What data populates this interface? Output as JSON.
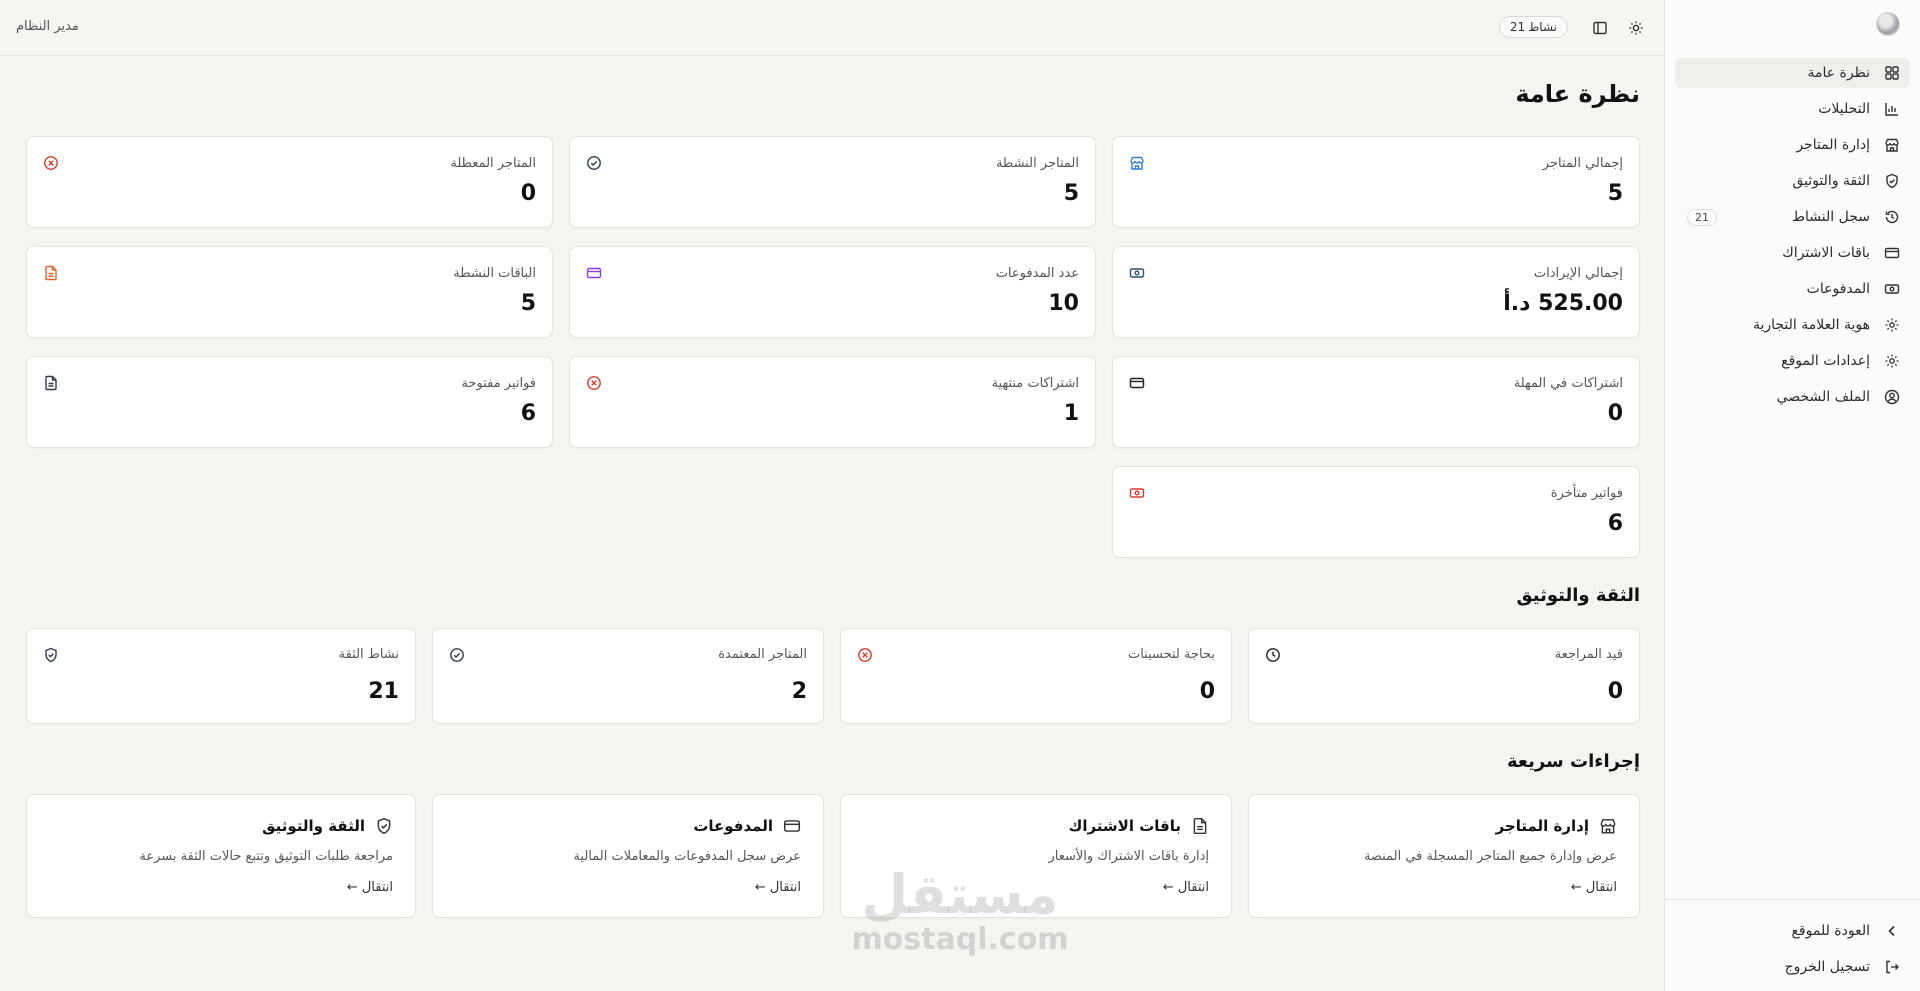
{
  "topbar": {
    "activity_label": "نشاط",
    "activity_count": "21",
    "admin_label": "مدير النظام"
  },
  "sidebar": {
    "items": [
      {
        "label": "نظرة عامة",
        "icon": "grid-icon"
      },
      {
        "label": "التحليلات",
        "icon": "bar-chart-icon"
      },
      {
        "label": "إدارة المتاجر",
        "icon": "store-icon"
      },
      {
        "label": "الثقة والتوثيق",
        "icon": "shield-check-icon"
      },
      {
        "label": "سجل النشاط",
        "icon": "history-icon",
        "badge": "21"
      },
      {
        "label": "باقات الاشتراك",
        "icon": "credit-card-icon"
      },
      {
        "label": "المدفوعات",
        "icon": "banknote-icon"
      },
      {
        "label": "هوية العلامة التجارية",
        "icon": "gear-icon"
      },
      {
        "label": "إعدادات الموقع",
        "icon": "gear-icon"
      },
      {
        "label": "الملف الشخصي",
        "icon": "user-circle-icon"
      }
    ],
    "footer": {
      "back_label": "العودة للموقع",
      "logout_label": "تسجيل الخروج"
    }
  },
  "main": {
    "title": "نظرة عامة",
    "stats": [
      {
        "label": "إجمالي المتاجر",
        "value": "5",
        "icon": "store-icon",
        "color": "#2b7fd3"
      },
      {
        "label": "المتاجر النشطة",
        "value": "5",
        "icon": "check-circle-icon",
        "color": "#2f3b4a"
      },
      {
        "label": "المتاجر المعطلة",
        "value": "0",
        "icon": "x-circle-icon",
        "color": "#d93b2b"
      },
      {
        "label": "إجمالي الإيرادات",
        "value": "525.00 د.أ",
        "icon": "banknote-icon",
        "color": "#2d4f78"
      },
      {
        "label": "عدد المدفوعات",
        "value": "10",
        "icon": "credit-card-icon",
        "color": "#8b3fd6"
      },
      {
        "label": "الباقات النشطة",
        "value": "5",
        "icon": "file-text-icon",
        "color": "#e0602a"
      },
      {
        "label": "اشتراكات في المهلة",
        "value": "0",
        "icon": "credit-card-icon",
        "color": "#222222"
      },
      {
        "label": "اشتراكات منتهية",
        "value": "1",
        "icon": "x-circle-icon",
        "color": "#d93b2b"
      },
      {
        "label": "فواتير مفتوحة",
        "value": "6",
        "icon": "file-text-icon",
        "color": "#2f3b4a"
      },
      {
        "label": "فواتير متأخرة",
        "value": "6",
        "icon": "banknote-icon",
        "color": "#d93b2b"
      }
    ],
    "trust_title": "الثقة والتوثيق",
    "trust": [
      {
        "label": "قيد المراجعة",
        "value": "0",
        "icon": "clock-icon",
        "color": "#222222"
      },
      {
        "label": "بحاجة لتحسينات",
        "value": "0",
        "icon": "x-circle-icon",
        "color": "#d93b2b"
      },
      {
        "label": "المتاجر المعتمدة",
        "value": "2",
        "icon": "check-circle-icon",
        "color": "#2f3b4a"
      },
      {
        "label": "نشاط الثقة",
        "value": "21",
        "icon": "shield-check-icon",
        "color": "#2f3b4a"
      }
    ],
    "quick_title": "إجراءات سريعة",
    "quick": [
      {
        "title": "إدارة المتاجر",
        "desc": "عرض وإدارة جميع المتاجر المسجلة في المنصة",
        "link": "انتقال ←",
        "icon": "store-icon"
      },
      {
        "title": "باقات الاشتراك",
        "desc": "إدارة باقات الاشتراك والأسعار",
        "link": "انتقال ←",
        "icon": "file-text-icon"
      },
      {
        "title": "المدفوعات",
        "desc": "عرض سجل المدفوعات والمعاملات المالية",
        "link": "انتقال ←",
        "icon": "credit-card-icon"
      },
      {
        "title": "الثقة والتوثيق",
        "desc": "مراجعة طلبات التوثيق وتتبع حالات الثقة بسرعة",
        "link": "انتقال ←",
        "icon": "shield-check-icon"
      }
    ]
  },
  "watermark": {
    "arabic": "مستقل",
    "latin": "mostaql.com"
  }
}
